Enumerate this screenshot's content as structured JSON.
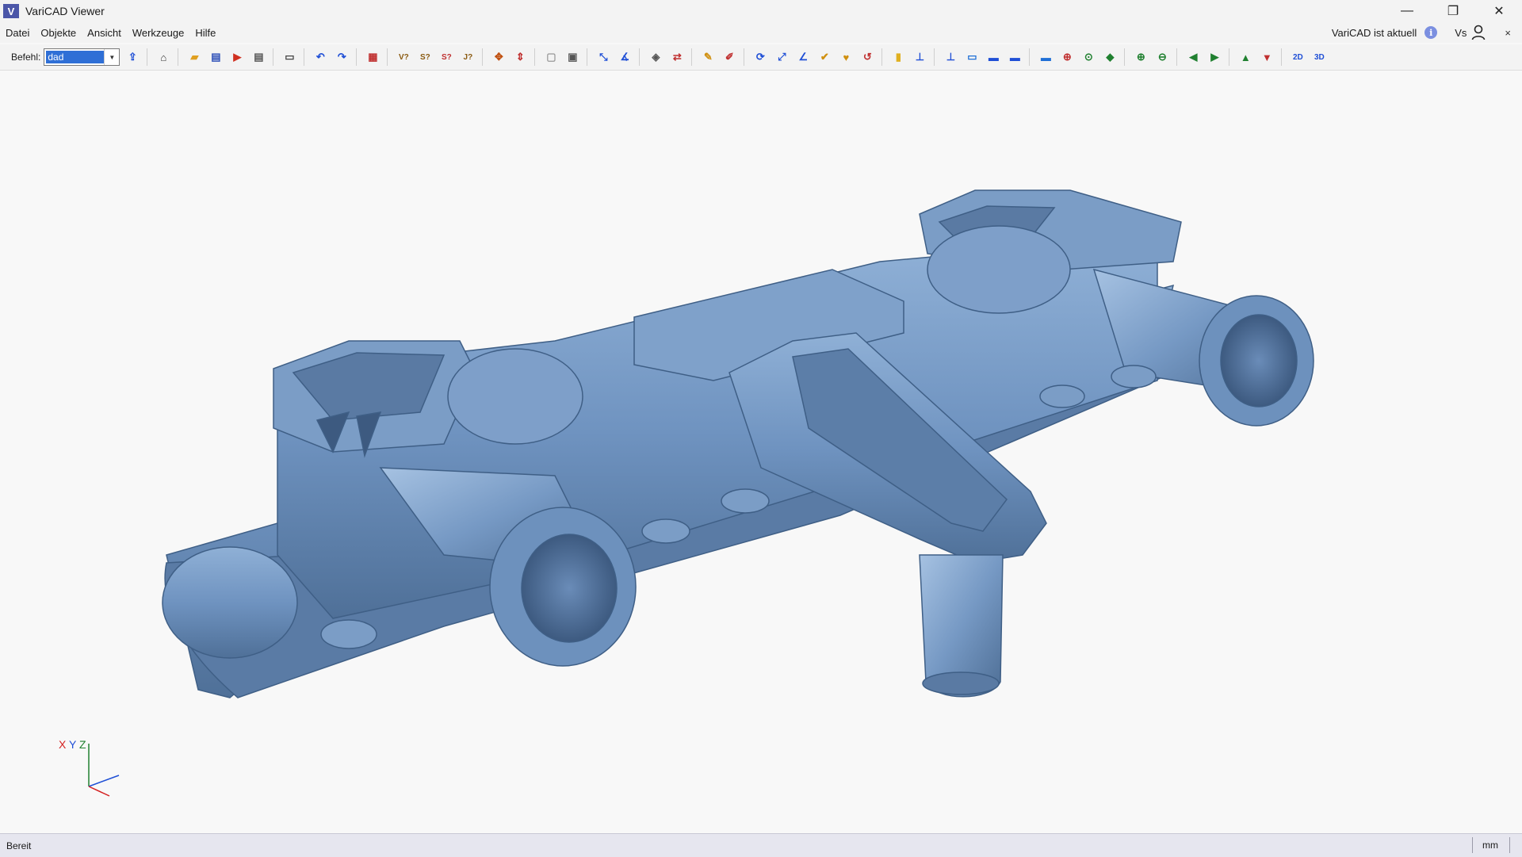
{
  "window": {
    "title": "VariCAD Viewer",
    "logo": "V"
  },
  "window_controls": {
    "minimize": "—",
    "restore": "❐",
    "close": "✕"
  },
  "menu": {
    "items": [
      "Datei",
      "Objekte",
      "Ansicht",
      "Werkzeuge",
      "Hilfe"
    ],
    "update_status": "VariCAD ist aktuell",
    "info": "i",
    "user": "Vs",
    "close": "×"
  },
  "toolbar": {
    "command_label": "Befehl:",
    "command_value": "dad",
    "buttons": [
      {
        "icon": "export-icon",
        "glyph": "⇪",
        "color": "#1f4fd6"
      },
      {
        "icon": "home-icon",
        "glyph": "⌂",
        "color": "#333333"
      },
      {
        "icon": "open-file-icon",
        "glyph": "▰",
        "color": "#e0a020"
      },
      {
        "icon": "save-icon",
        "glyph": "▤",
        "color": "#2c4fb8"
      },
      {
        "icon": "save-pdf-icon",
        "glyph": "▶",
        "color": "#d03020"
      },
      {
        "icon": "save-as-icon",
        "glyph": "▤",
        "color": "#555555"
      },
      {
        "icon": "print-icon",
        "glyph": "▭",
        "color": "#444444"
      },
      {
        "icon": "undo-icon",
        "glyph": "↶",
        "color": "#1f4fd6"
      },
      {
        "icon": "redo-icon",
        "glyph": "↷",
        "color": "#1f4fd6"
      },
      {
        "icon": "object-list-icon",
        "glyph": "▦",
        "color": "#c03030"
      },
      {
        "icon": "query-v-icon",
        "glyph": "V?",
        "color": "#8a5a10"
      },
      {
        "icon": "query-s-icon",
        "glyph": "S?",
        "color": "#8a5a10"
      },
      {
        "icon": "query-s2-icon",
        "glyph": "S?",
        "color": "#c03030"
      },
      {
        "icon": "query-j-icon",
        "glyph": "J?",
        "color": "#8a5a10"
      },
      {
        "icon": "explode-icon",
        "glyph": "✥",
        "color": "#c05010"
      },
      {
        "icon": "section-icon",
        "glyph": "⇕",
        "color": "#c03030"
      },
      {
        "icon": "box-light-icon",
        "glyph": "▢",
        "color": "#9a9a9a"
      },
      {
        "icon": "box-icon",
        "glyph": "▣",
        "color": "#555555"
      },
      {
        "icon": "measure-axes-icon",
        "glyph": "⤡",
        "color": "#1f4fd6"
      },
      {
        "icon": "measure-angle-icon",
        "glyph": "∡",
        "color": "#1f4fd6"
      },
      {
        "icon": "cube-view-icon",
        "glyph": "◈",
        "color": "#555555"
      },
      {
        "icon": "compare-icon",
        "glyph": "⇄",
        "color": "#c03030"
      },
      {
        "icon": "measure-pick-icon",
        "glyph": "✎",
        "color": "#d09010"
      },
      {
        "icon": "measure-dist-icon",
        "glyph": "✐",
        "color": "#c03030"
      },
      {
        "icon": "rotate-icon",
        "glyph": "⟳",
        "color": "#1f4fd6"
      },
      {
        "icon": "rotate-axis-icon",
        "glyph": "⤢",
        "color": "#1f4fd6"
      },
      {
        "icon": "angle-icon",
        "glyph": "∠",
        "color": "#1f4fd6"
      },
      {
        "icon": "check-icon",
        "glyph": "✔",
        "color": "#d09010"
      },
      {
        "icon": "mirror-icon",
        "glyph": "♥",
        "color": "#d09010"
      },
      {
        "icon": "transform-icon",
        "glyph": "↺",
        "color": "#c03030"
      },
      {
        "icon": "highlight-icon",
        "glyph": "▮",
        "color": "#e0b020"
      },
      {
        "icon": "plane-icon",
        "glyph": "⊥",
        "color": "#1f4fd6"
      },
      {
        "icon": "plane2-icon",
        "glyph": "⊥",
        "color": "#1f4fd6"
      },
      {
        "icon": "view-front-icon",
        "glyph": "▭",
        "color": "#1f6fd6"
      },
      {
        "icon": "view-top-icon",
        "glyph": "▬",
        "color": "#1f4fd6"
      },
      {
        "icon": "view-side-icon",
        "glyph": "▬",
        "color": "#1f4fd6"
      },
      {
        "icon": "view-flat-icon",
        "glyph": "▬",
        "color": "#1f6fd6"
      },
      {
        "icon": "zoom-window-icon",
        "glyph": "⊕",
        "color": "#c03030"
      },
      {
        "icon": "zoom-all-icon",
        "glyph": "⊙",
        "color": "#208030"
      },
      {
        "icon": "render-icon",
        "glyph": "◆",
        "color": "#208030"
      },
      {
        "icon": "zoom-in-icon",
        "glyph": "⊕",
        "color": "#208030"
      },
      {
        "icon": "zoom-out-icon",
        "glyph": "⊖",
        "color": "#208030"
      },
      {
        "icon": "prev-view-icon",
        "glyph": "◀",
        "color": "#208030"
      },
      {
        "icon": "next-view-icon",
        "glyph": "▶",
        "color": "#208030"
      },
      {
        "icon": "upload-icon",
        "glyph": "▲",
        "color": "#208030"
      },
      {
        "icon": "download-icon",
        "glyph": "▼",
        "color": "#c03030"
      },
      {
        "icon": "mode-2d-icon",
        "glyph": "2D",
        "color": "#1f4fd6"
      },
      {
        "icon": "mode-3d-icon",
        "glyph": "3D",
        "color": "#1f4fd6"
      }
    ]
  },
  "axis": {
    "x": "X",
    "y": "Y",
    "z": "Z",
    "x_color": "#d42020",
    "y_color": "#1f4fd6",
    "z_color": "#208030"
  },
  "status": {
    "text": "Bereit",
    "unit": "mm"
  },
  "model": {
    "color": "#6f93c0",
    "edge_color": "#3f5f86"
  }
}
